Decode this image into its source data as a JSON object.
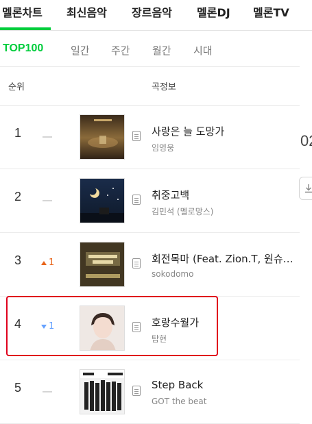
{
  "top_nav": [
    "멜론차트",
    "최신음악",
    "장르음악",
    "멜론DJ",
    "멜론TV"
  ],
  "sub_nav": [
    "TOP100",
    "일간",
    "주간",
    "월간",
    "시대"
  ],
  "table_header": {
    "rank": "순위",
    "song_info": "곡정보"
  },
  "songs": [
    {
      "rank": "1",
      "change": "",
      "change_dir": "none",
      "title": "사랑은 늘 도망가",
      "artist": "임영웅"
    },
    {
      "rank": "2",
      "change": "",
      "change_dir": "none",
      "title": "취중고백",
      "artist": "김민석 (멜로망스)"
    },
    {
      "rank": "3",
      "change": "1",
      "change_dir": "up",
      "title": "회전목마 (Feat. Zion.T, 원슈타인) (Prod. Slom)",
      "artist": "sokodomo"
    },
    {
      "rank": "4",
      "change": "1",
      "change_dir": "down",
      "title": "호랑수월가",
      "artist": "탑현"
    },
    {
      "rank": "5",
      "change": "",
      "change_dir": "none",
      "title": "Step Back",
      "artist": "GOT the beat"
    }
  ],
  "side_partial_text": "02",
  "colors": {
    "accent": "#00cd3c",
    "up": "#e8641a",
    "down": "#66a2ff",
    "highlight": "#e0001b"
  }
}
